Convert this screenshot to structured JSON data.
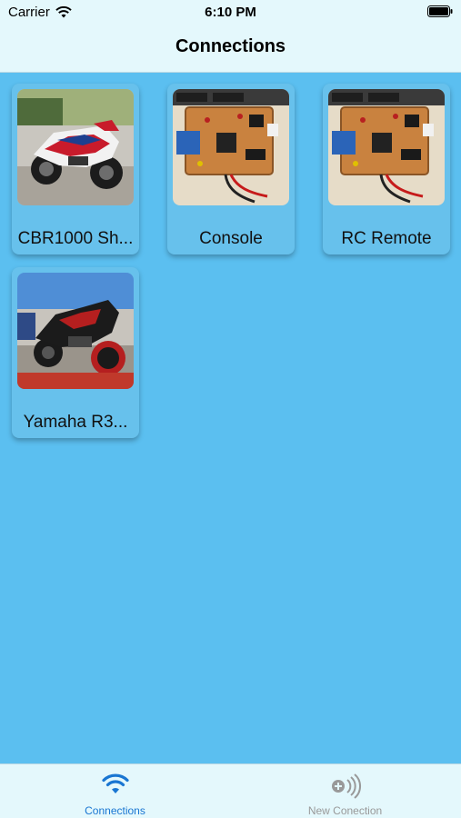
{
  "status_bar": {
    "carrier": "Carrier",
    "time": "6:10 PM"
  },
  "nav": {
    "title": "Connections"
  },
  "connections": [
    {
      "label": "CBR1000 Sh...",
      "image": "red-white-sport-motorcycle"
    },
    {
      "label": "Console",
      "image": "circuit-board"
    },
    {
      "label": "RC Remote",
      "image": "circuit-board"
    },
    {
      "label": "Yamaha R3...",
      "image": "red-black-sport-motorcycle"
    }
  ],
  "tabs": [
    {
      "label": "Connections",
      "icon": "wifi-icon",
      "active": true
    },
    {
      "label": "New Conection",
      "icon": "add-signal-icon",
      "active": false
    }
  ],
  "colors": {
    "background": "#5bbff0",
    "bar": "#e4f8fc",
    "active_tab": "#1976d2",
    "inactive_tab": "#999999"
  }
}
